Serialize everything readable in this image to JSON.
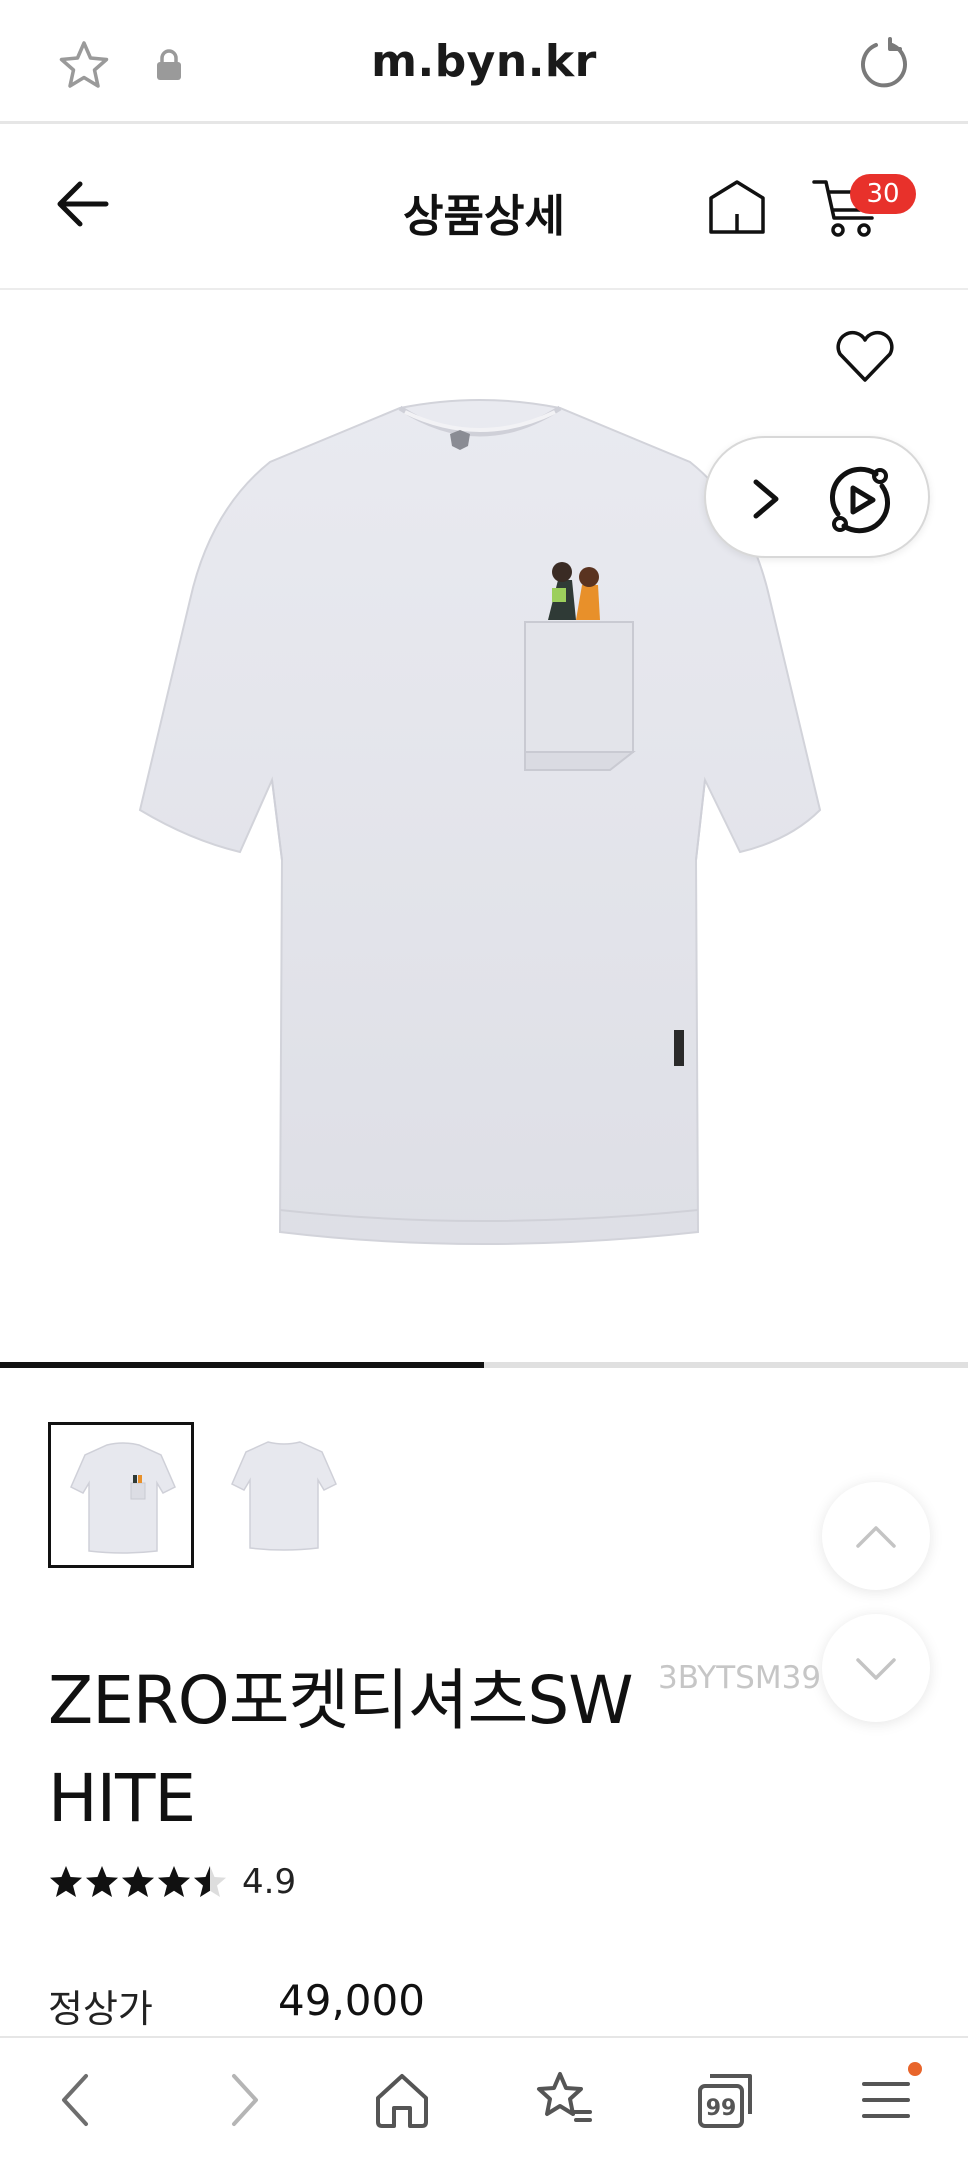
{
  "browser": {
    "url": "m.byn.kr"
  },
  "header": {
    "title": "상품상세",
    "cart_count": "30"
  },
  "gallery": {
    "image_count": 2,
    "current_index": 1,
    "progress": 0.5
  },
  "product": {
    "name": "ZERO포켓티셔츠SWHITE",
    "code": "3BYTSM39",
    "rating": "4.9",
    "rating_value": 4.5,
    "price_label": "정상가",
    "price": "49,000"
  },
  "colors": {
    "badge": "#e8312b",
    "accent_dot": "#e8652b",
    "progress_fill": "#111111",
    "code_text": "#c6c6c6"
  },
  "icons": {
    "url_star": "star-outline-icon",
    "lock": "lock-icon",
    "reload": "reload-icon",
    "back": "arrow-left-icon",
    "home": "home-icon",
    "cart": "cart-icon",
    "wish": "heart-outline-icon",
    "next": "chevron-right-icon",
    "video": "video-play-icon",
    "scroll_up": "chevron-up-icon",
    "scroll_down": "chevron-down-icon",
    "tb_back": "chevron-left-icon",
    "tb_forward": "chevron-right-icon",
    "tb_home": "home-icon",
    "tb_bookmarks": "bookmark-star-icon",
    "tb_tabs": "tabs-icon",
    "tb_menu": "menu-icon"
  },
  "toolbar": {
    "tabs_count": "99"
  }
}
